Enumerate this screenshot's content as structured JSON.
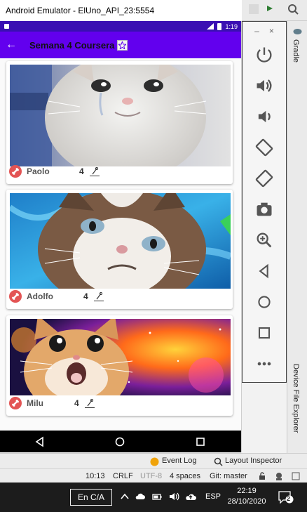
{
  "window": {
    "title": "Android Emulator - ElUno_API_23:5554"
  },
  "statusbar": {
    "time": "1:19"
  },
  "appbar": {
    "title": "Semana 4 Coursera",
    "action_icon": "star-icon"
  },
  "pets": [
    {
      "name": "Paolo",
      "likes": "4",
      "photo": "crying-cat"
    },
    {
      "name": "Adolfo",
      "likes": "4",
      "photo": "grumpy-cat"
    },
    {
      "name": "Milu",
      "likes": "4",
      "photo": "surprised-cat-space"
    }
  ],
  "emulator_panel": {
    "minimize": "–",
    "close": "×",
    "buttons": [
      "power-icon",
      "volume-up-icon",
      "volume-down-icon",
      "rotate-left-icon",
      "rotate-right-icon",
      "camera-icon",
      "zoom-icon",
      "back-icon",
      "home-icon",
      "overview-icon",
      "more-icon"
    ]
  },
  "ide": {
    "right_tabs": [
      "Gradle",
      "Device File Explorer"
    ],
    "toolbar": [
      "Event Log",
      "Layout Inspector"
    ],
    "status": {
      "position": "10:13",
      "line_sep": "CRLF",
      "encoding": "UTF-8",
      "indent": "4 spaces",
      "git": "Git: master"
    }
  },
  "taskbar": {
    "ime": "En C/A",
    "lang": "ESP",
    "time": "22:19",
    "date": "28/10/2020",
    "notifications": "2"
  },
  "colors": {
    "primary": "#6200ee",
    "status": "#3a0fb3",
    "bone": "#e35454"
  }
}
